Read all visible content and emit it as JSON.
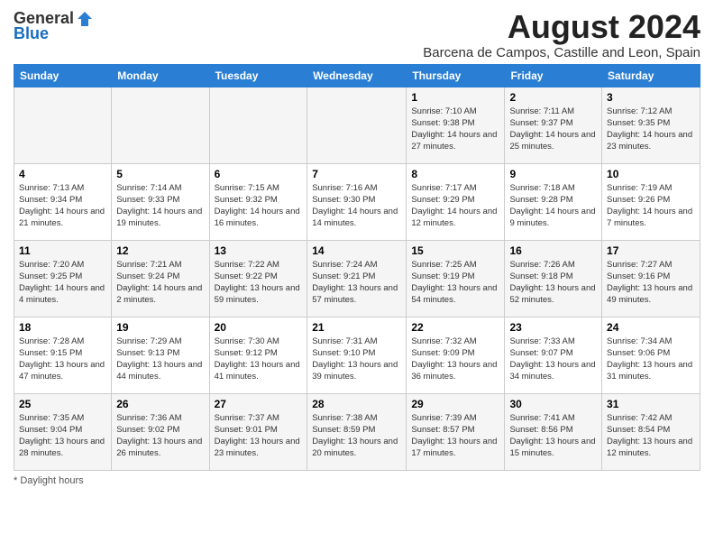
{
  "header": {
    "logo_general": "General",
    "logo_blue": "Blue",
    "main_title": "August 2024",
    "subtitle": "Barcena de Campos, Castille and Leon, Spain"
  },
  "calendar": {
    "columns": [
      "Sunday",
      "Monday",
      "Tuesday",
      "Wednesday",
      "Thursday",
      "Friday",
      "Saturday"
    ],
    "weeks": [
      [
        {
          "day": "",
          "info": ""
        },
        {
          "day": "",
          "info": ""
        },
        {
          "day": "",
          "info": ""
        },
        {
          "day": "",
          "info": ""
        },
        {
          "day": "1",
          "info": "Sunrise: 7:10 AM\nSunset: 9:38 PM\nDaylight: 14 hours and 27 minutes."
        },
        {
          "day": "2",
          "info": "Sunrise: 7:11 AM\nSunset: 9:37 PM\nDaylight: 14 hours and 25 minutes."
        },
        {
          "day": "3",
          "info": "Sunrise: 7:12 AM\nSunset: 9:35 PM\nDaylight: 14 hours and 23 minutes."
        }
      ],
      [
        {
          "day": "4",
          "info": "Sunrise: 7:13 AM\nSunset: 9:34 PM\nDaylight: 14 hours and 21 minutes."
        },
        {
          "day": "5",
          "info": "Sunrise: 7:14 AM\nSunset: 9:33 PM\nDaylight: 14 hours and 19 minutes."
        },
        {
          "day": "6",
          "info": "Sunrise: 7:15 AM\nSunset: 9:32 PM\nDaylight: 14 hours and 16 minutes."
        },
        {
          "day": "7",
          "info": "Sunrise: 7:16 AM\nSunset: 9:30 PM\nDaylight: 14 hours and 14 minutes."
        },
        {
          "day": "8",
          "info": "Sunrise: 7:17 AM\nSunset: 9:29 PM\nDaylight: 14 hours and 12 minutes."
        },
        {
          "day": "9",
          "info": "Sunrise: 7:18 AM\nSunset: 9:28 PM\nDaylight: 14 hours and 9 minutes."
        },
        {
          "day": "10",
          "info": "Sunrise: 7:19 AM\nSunset: 9:26 PM\nDaylight: 14 hours and 7 minutes."
        }
      ],
      [
        {
          "day": "11",
          "info": "Sunrise: 7:20 AM\nSunset: 9:25 PM\nDaylight: 14 hours and 4 minutes."
        },
        {
          "day": "12",
          "info": "Sunrise: 7:21 AM\nSunset: 9:24 PM\nDaylight: 14 hours and 2 minutes."
        },
        {
          "day": "13",
          "info": "Sunrise: 7:22 AM\nSunset: 9:22 PM\nDaylight: 13 hours and 59 minutes."
        },
        {
          "day": "14",
          "info": "Sunrise: 7:24 AM\nSunset: 9:21 PM\nDaylight: 13 hours and 57 minutes."
        },
        {
          "day": "15",
          "info": "Sunrise: 7:25 AM\nSunset: 9:19 PM\nDaylight: 13 hours and 54 minutes."
        },
        {
          "day": "16",
          "info": "Sunrise: 7:26 AM\nSunset: 9:18 PM\nDaylight: 13 hours and 52 minutes."
        },
        {
          "day": "17",
          "info": "Sunrise: 7:27 AM\nSunset: 9:16 PM\nDaylight: 13 hours and 49 minutes."
        }
      ],
      [
        {
          "day": "18",
          "info": "Sunrise: 7:28 AM\nSunset: 9:15 PM\nDaylight: 13 hours and 47 minutes."
        },
        {
          "day": "19",
          "info": "Sunrise: 7:29 AM\nSunset: 9:13 PM\nDaylight: 13 hours and 44 minutes."
        },
        {
          "day": "20",
          "info": "Sunrise: 7:30 AM\nSunset: 9:12 PM\nDaylight: 13 hours and 41 minutes."
        },
        {
          "day": "21",
          "info": "Sunrise: 7:31 AM\nSunset: 9:10 PM\nDaylight: 13 hours and 39 minutes."
        },
        {
          "day": "22",
          "info": "Sunrise: 7:32 AM\nSunset: 9:09 PM\nDaylight: 13 hours and 36 minutes."
        },
        {
          "day": "23",
          "info": "Sunrise: 7:33 AM\nSunset: 9:07 PM\nDaylight: 13 hours and 34 minutes."
        },
        {
          "day": "24",
          "info": "Sunrise: 7:34 AM\nSunset: 9:06 PM\nDaylight: 13 hours and 31 minutes."
        }
      ],
      [
        {
          "day": "25",
          "info": "Sunrise: 7:35 AM\nSunset: 9:04 PM\nDaylight: 13 hours and 28 minutes."
        },
        {
          "day": "26",
          "info": "Sunrise: 7:36 AM\nSunset: 9:02 PM\nDaylight: 13 hours and 26 minutes."
        },
        {
          "day": "27",
          "info": "Sunrise: 7:37 AM\nSunset: 9:01 PM\nDaylight: 13 hours and 23 minutes."
        },
        {
          "day": "28",
          "info": "Sunrise: 7:38 AM\nSunset: 8:59 PM\nDaylight: 13 hours and 20 minutes."
        },
        {
          "day": "29",
          "info": "Sunrise: 7:39 AM\nSunset: 8:57 PM\nDaylight: 13 hours and 17 minutes."
        },
        {
          "day": "30",
          "info": "Sunrise: 7:41 AM\nSunset: 8:56 PM\nDaylight: 13 hours and 15 minutes."
        },
        {
          "day": "31",
          "info": "Sunrise: 7:42 AM\nSunset: 8:54 PM\nDaylight: 13 hours and 12 minutes."
        }
      ]
    ]
  },
  "footer": {
    "note": "Daylight hours"
  }
}
